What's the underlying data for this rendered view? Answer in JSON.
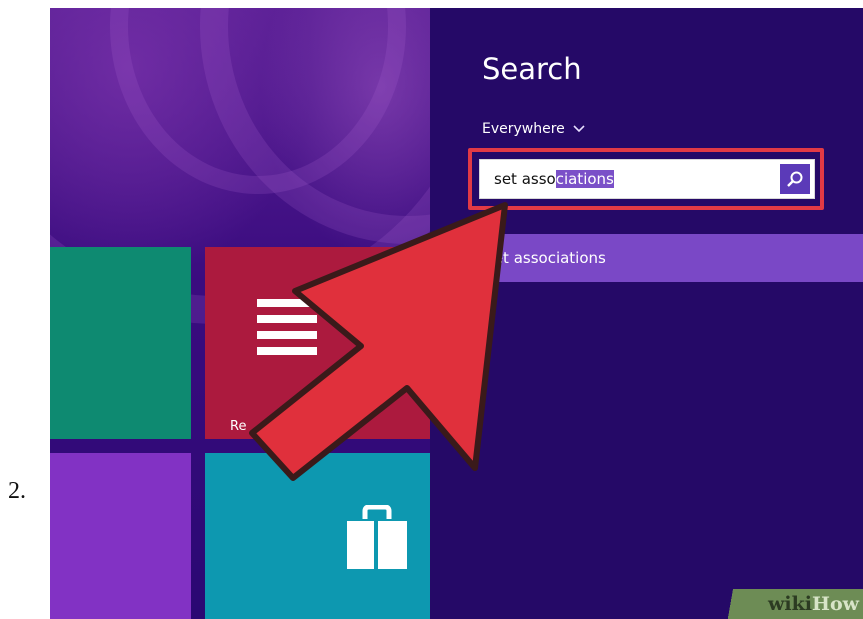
{
  "step": {
    "number": "2."
  },
  "start_screen": {
    "tiles": [
      {
        "name": "green-tile",
        "color": "#0e8a71"
      },
      {
        "name": "reading-tile",
        "color": "#ac1a3e",
        "label": "Re"
      },
      {
        "name": "purple-tile",
        "color": "#8232c4"
      },
      {
        "name": "store-tile",
        "color": "#0d98b0"
      }
    ],
    "icons": {
      "reading": "reading-list-icon",
      "store": "store-bag-icon"
    }
  },
  "search_pane": {
    "title": "Search",
    "scope": "Everywhere",
    "scope_icon": "chevron-down-icon",
    "query_typed": "set asso",
    "query_autocomplete": "ciations",
    "search_icon": "search-icon",
    "suggestion": "set associations",
    "highlight_color": "#e23a45",
    "pane_color": "#250967",
    "suggestion_color": "#7a48c6"
  },
  "annotation": {
    "arrow_icon": "pointer-arrow-icon",
    "arrow_color": "#e23a45"
  },
  "watermark": {
    "part1": "wiki",
    "part2": "How"
  }
}
